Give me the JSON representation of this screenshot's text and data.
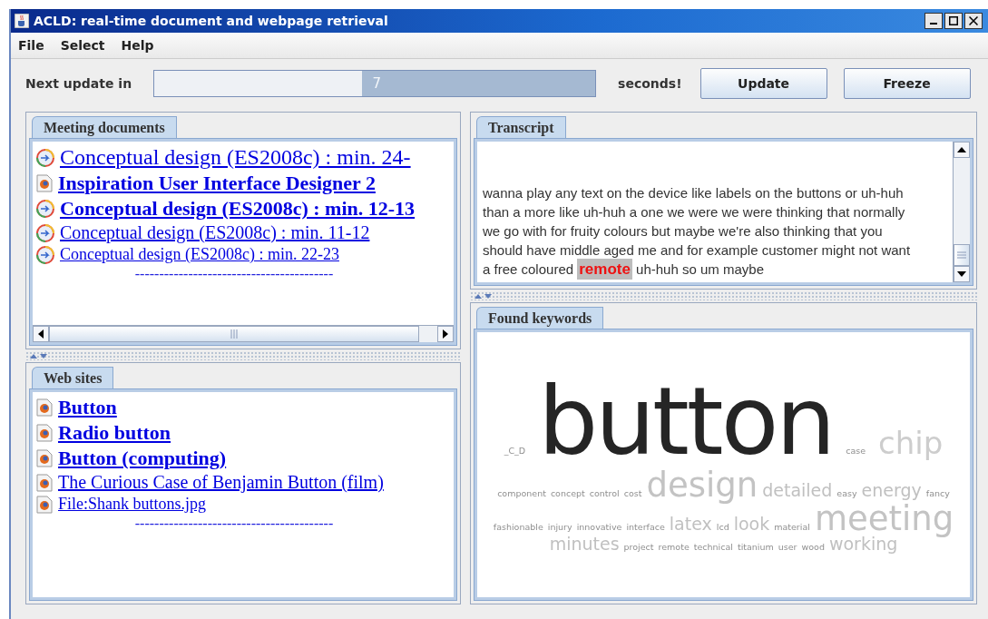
{
  "window": {
    "title": "ACLD: real-time document and webpage retrieval"
  },
  "menu": [
    "File",
    "Select",
    "Help"
  ],
  "toolbar": {
    "label": "Next update in",
    "progress": {
      "level": 0.53,
      "reading": "7"
    },
    "suffix": "seconds!",
    "buttons": [
      "Update",
      "Freeze"
    ]
  },
  "meeting_documents": {
    "tab": "Meeting documents",
    "items": [
      {
        "kind": "meetingxl",
        "text": "Conceptual design (ES2008c) : min. 24-"
      },
      {
        "kind": "webhigh",
        "text": "Inspiration User Interface Designer 2"
      },
      {
        "kind": "meetinghigh",
        "text": "Conceptual design (ES2008c) : min. 12-13"
      },
      {
        "kind": "meetingmedium",
        "text": "Conceptual design (ES2008c) : min. 11-12"
      },
      {
        "kind": "meetinglow",
        "text": "Conceptual design (ES2008c) : min. 22-23"
      }
    ],
    "separator": "-----------------------------------------"
  },
  "web_sites": {
    "tab": "Web sites",
    "items": [
      {
        "kind": "webhigh",
        "text": "Button "
      },
      {
        "kind": "webhigh",
        "text": "Radio button "
      },
      {
        "kind": "webhigh",
        "text": "Button (computing) "
      },
      {
        "kind": "webmedium",
        "text": "The Curious Case of Benjamin Button (film) "
      },
      {
        "kind": "weblow",
        "text": "File:Shank buttons.jpg "
      }
    ],
    "separator": "-----------------------------------------"
  },
  "transcript": {
    "tab": "Transcript",
    "segments": [
      {
        "text": "wanna play any text on the device like labels on the buttons or uh-huh than a more like uh-huh a one we were we were thinking that normally we go with for fruity colours but maybe we're also thinking that you should have middle aged me and for example customer might not want a free coloured ",
        "highlight": false
      },
      {
        "text": "remote",
        "highlight": true
      },
      {
        "text": " uh-huh so um maybe",
        "highlight": false
      }
    ]
  },
  "found_keywords": {
    "tab": "Found keywords",
    "lines": [
      [
        {
          "text": "_C_D",
          "kind": "s"
        },
        {
          "text": "button",
          "kind": "top"
        },
        {
          "text": "case",
          "kind": "s"
        },
        {
          "text": "chip",
          "kind": "l"
        }
      ],
      [
        {
          "text": "component",
          "kind": "s"
        },
        {
          "text": "concept",
          "kind": "s"
        },
        {
          "text": "control",
          "kind": "s"
        },
        {
          "text": "cost",
          "kind": "s"
        },
        {
          "text": "design",
          "kind": "xl"
        },
        {
          "text": "detailed",
          "kind": "m"
        },
        {
          "text": "easy",
          "kind": "s"
        },
        {
          "text": "energy",
          "kind": "m"
        },
        {
          "text": "fancy",
          "kind": "s"
        }
      ],
      [
        {
          "text": "fashionable",
          "kind": "s"
        },
        {
          "text": "injury",
          "kind": "s"
        },
        {
          "text": "innovative",
          "kind": "s"
        },
        {
          "text": "interface",
          "kind": "s"
        },
        {
          "text": "latex",
          "kind": "m"
        },
        {
          "text": "lcd",
          "kind": "s"
        },
        {
          "text": "look",
          "kind": "m"
        },
        {
          "text": "material",
          "kind": "s"
        },
        {
          "text": "meeting",
          "kind": "xl"
        }
      ],
      [
        {
          "text": "minutes",
          "kind": "m"
        },
        {
          "text": "project",
          "kind": "s"
        },
        {
          "text": "remote",
          "kind": "s"
        },
        {
          "text": "technical",
          "kind": "s"
        },
        {
          "text": "titanium",
          "kind": "s"
        },
        {
          "text": "user",
          "kind": "s"
        },
        {
          "text": "wood",
          "kind": "s"
        },
        {
          "text": "working",
          "kind": "m"
        }
      ]
    ]
  }
}
